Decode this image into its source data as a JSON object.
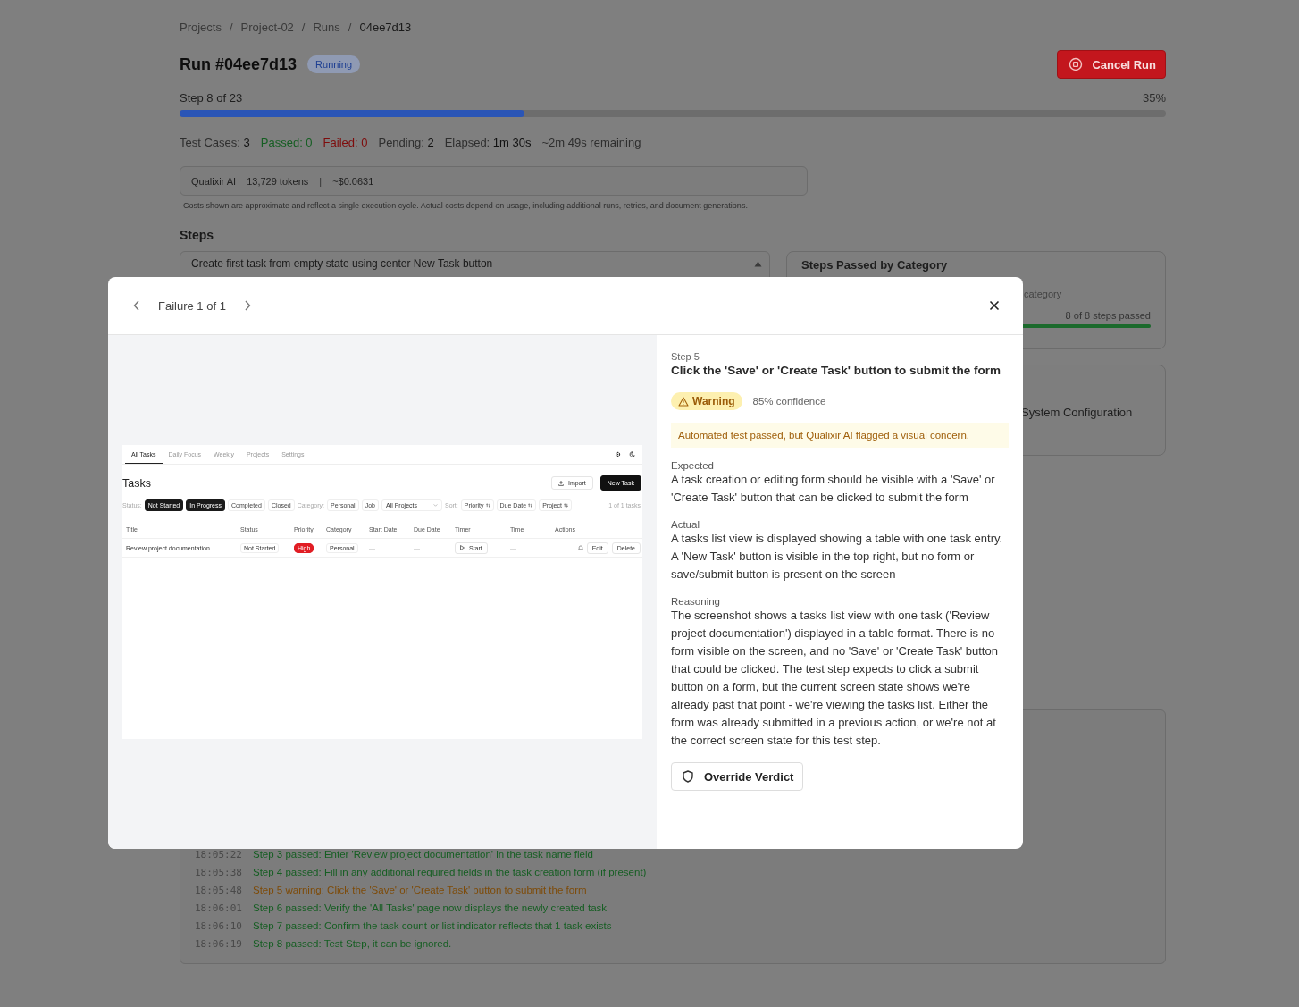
{
  "breadcrumb": {
    "separator": "/",
    "items": [
      "Projects",
      "Project-02",
      "Runs",
      "04ee7d13"
    ]
  },
  "run": {
    "title": "Run #04ee7d13",
    "status": "Running",
    "cancel_button": "Cancel Run"
  },
  "progress": {
    "label": "Step 8 of 23",
    "percent": "35%",
    "level": 0.35
  },
  "stats": [
    {
      "label": "Test Cases:",
      "value": "3",
      "kind": "neutral"
    },
    {
      "label": "Passed:",
      "value": "0",
      "kind": "passed"
    },
    {
      "label": "Failed:",
      "value": "0",
      "kind": "failed"
    },
    {
      "label": "Pending:",
      "value": "2",
      "kind": "neutral"
    },
    {
      "label": "Elapsed:",
      "value": "1m 30s",
      "kind": "neutral"
    },
    {
      "label": "~2m 49s remaining",
      "kind": "plain"
    }
  ],
  "cost": {
    "provider": "Qualixir AI",
    "tokens": "13,729 tokens",
    "separator": "|",
    "amount": "~$0.0631",
    "note": "Costs shown are approximate and reflect a single execution cycle. Actual costs depend on usage, including additional runs, retries, and document generations."
  },
  "steps": {
    "heading": "Steps",
    "first_step": "Create first task from empty state using center New Task button",
    "expanded": true
  },
  "category_card": {
    "title": "Steps Passed by Category",
    "subtitle": "category",
    "summary": "8 of 8 steps passed",
    "level": 1
  },
  "config_card": {
    "title": "System Configuration"
  },
  "log": [
    {
      "time": "18:05:22",
      "text": "Step 3 passed: Enter 'Review project documentation' in the task name field",
      "kind": "passed"
    },
    {
      "time": "18:05:38",
      "text": "Step 4 passed: Fill in any additional required fields in the task creation form (if present)",
      "kind": "passed"
    },
    {
      "time": "18:05:48",
      "text": "Step 5 warning: Click the 'Save' or 'Create Task' button to submit the form",
      "kind": "warning"
    },
    {
      "time": "18:06:01",
      "text": "Step 6 passed: Verify the 'All Tasks' page now displays the newly created task",
      "kind": "passed"
    },
    {
      "time": "18:06:10",
      "text": "Step 7 passed: Confirm the task count or list indicator reflects that 1 task exists",
      "kind": "passed"
    },
    {
      "time": "18:06:19",
      "text": "Step 8 passed: Test Step, it can be ignored.",
      "kind": "passed"
    }
  ],
  "modal": {
    "nav": "Failure 1 of 1",
    "screenshot": {
      "tabs": [
        {
          "label": "All Tasks",
          "selected": true
        },
        {
          "label": "Daily Focus",
          "selected": false
        },
        {
          "label": "Weekly",
          "selected": false
        },
        {
          "label": "Projects",
          "selected": false
        },
        {
          "label": "Settings",
          "selected": false
        }
      ],
      "heading": "Tasks",
      "import_button": "Import",
      "new_button": "New Task",
      "filters": [
        {
          "kind": "label",
          "text": "Status:"
        },
        {
          "kind": "chip",
          "text": "Not Started",
          "selected": true
        },
        {
          "kind": "chip",
          "text": "In Progress",
          "selected": true
        },
        {
          "kind": "chip",
          "text": "Completed",
          "selected": false
        },
        {
          "kind": "chip",
          "text": "Closed",
          "selected": false
        },
        {
          "kind": "label",
          "text": "Category:"
        },
        {
          "kind": "chip",
          "text": "Personal",
          "selected": false
        },
        {
          "kind": "chip",
          "text": "Job",
          "selected": false
        },
        {
          "kind": "select",
          "text": "All Projects"
        },
        {
          "kind": "label",
          "text": "Sort:"
        },
        {
          "kind": "sort",
          "text": "Priority"
        },
        {
          "kind": "sort",
          "text": "Due Date"
        },
        {
          "kind": "sort",
          "text": "Project"
        }
      ],
      "count": "1 of 1 tasks",
      "columns": [
        "Title",
        "Status",
        "Priority",
        "Category",
        "Start Date",
        "Due Date",
        "Timer",
        "Time",
        "Actions"
      ],
      "row": {
        "title": "Review project documentation",
        "status": "Not Started",
        "priority": "High",
        "category": "Personal",
        "start": "—",
        "due": "—",
        "timer": "Start",
        "time": "—",
        "edit": "Edit",
        "delete": "Delete"
      }
    },
    "step_label": "Step 5",
    "title": "Click the 'Save' or 'Create Task' button to submit the form",
    "badge": "Warning",
    "confidence": "85% confidence",
    "alert": "Automated test passed, but Qualixir AI flagged a visual concern.",
    "sections": [
      {
        "heading": "Expected",
        "body": "A task creation or editing form should be visible with a 'Save' or 'Create Task' button that can be clicked to submit the form"
      },
      {
        "heading": "Actual",
        "body": "A tasks list view is displayed showing a table with one task entry. A 'New Task' button is visible in the top right, but no form or save/submit button is present on the screen"
      },
      {
        "heading": "Reasoning",
        "body": "The screenshot shows a tasks list view with one task ('Review project documentation') displayed in a table format. There is no form visible on the screen, and no 'Save' or 'Create Task' button that could be clicked. The test step expects to click a submit button on a form, but the current screen state shows we're already past that point - we're viewing the tasks list. Either the form was already submitted in a previous action, or we're not at the correct screen state for this test step."
      }
    ],
    "override_button": "Override Verdict"
  }
}
